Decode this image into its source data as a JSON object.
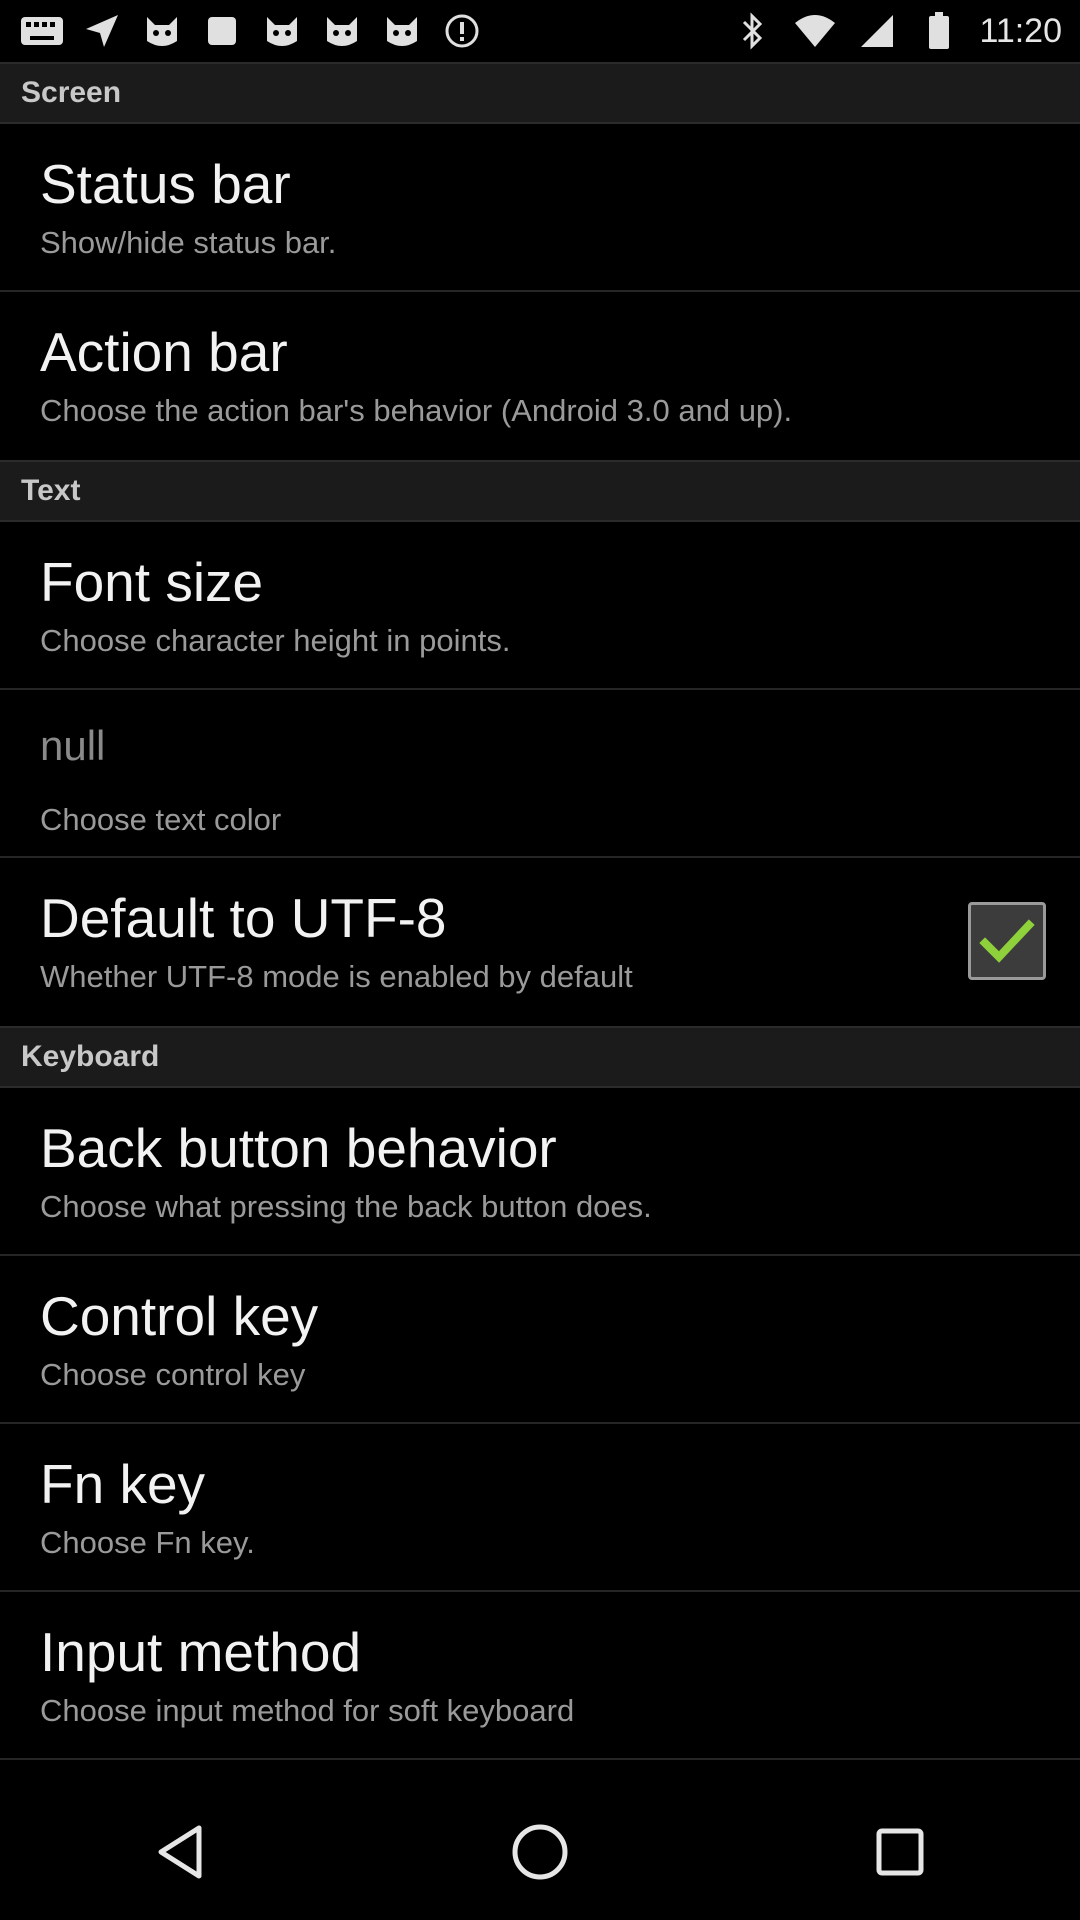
{
  "status_bar": {
    "time": "11:20",
    "left_icons": [
      "keyboard-icon",
      "navigation-arrow-icon",
      "cat-face-icon",
      "square-icon",
      "cat-face-icon",
      "cat-face-icon",
      "cat-face-icon",
      "alert-icon"
    ],
    "right_icons": [
      "bluetooth-icon",
      "wifi-icon",
      "signal-icon",
      "battery-icon"
    ]
  },
  "sections": [
    {
      "category": "Screen",
      "items": [
        {
          "title": "Status bar",
          "summary": "Show/hide status bar."
        },
        {
          "title": "Action bar",
          "summary": "Choose the action bar's behavior (Android 3.0 and up)."
        }
      ]
    },
    {
      "category": "Text",
      "items": [
        {
          "title": "Font size",
          "summary": "Choose character height in points."
        },
        {
          "title": "null",
          "summary": "Choose text color"
        },
        {
          "title": "Default to UTF-8",
          "summary": "Whether UTF-8 mode is enabled by default",
          "checked": true
        }
      ]
    },
    {
      "category": "Keyboard",
      "items": [
        {
          "title": "Back button behavior",
          "summary": "Choose what pressing the back button does."
        },
        {
          "title": "Control key",
          "summary": "Choose control key"
        },
        {
          "title": "Fn key",
          "summary": "Choose Fn key."
        },
        {
          "title": "Input method",
          "summary": "Choose input method for soft keyboard"
        }
      ]
    }
  ],
  "navigation": {
    "buttons": [
      "back-icon",
      "home-icon",
      "recents-icon"
    ]
  },
  "colors": {
    "background": "#000000",
    "category_bg": "#1b1b1b",
    "check_mark": "#8ed13a"
  }
}
